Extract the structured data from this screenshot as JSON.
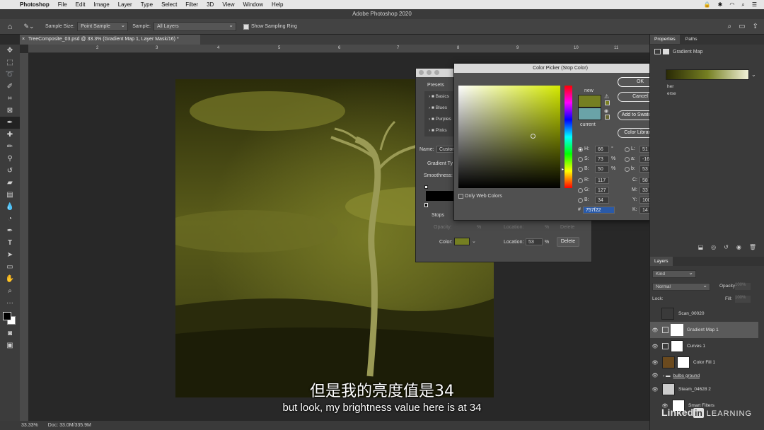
{
  "menubar": {
    "app_name": "Photoshop",
    "items": [
      "File",
      "Edit",
      "Image",
      "Layer",
      "Type",
      "Select",
      "Filter",
      "3D",
      "View",
      "Window",
      "Help"
    ]
  },
  "window_title": "Adobe Photoshop 2020",
  "options_bar": {
    "sample_size_label": "Sample Size:",
    "sample_size_value": "Point Sample",
    "sample_label": "Sample:",
    "sample_value": "All Layers",
    "show_sampling_ring": "Show Sampling Ring"
  },
  "document_tab": "TreeComposite_03.psd @ 33.3% (Gradient Map 1, Layer Mask/16) *",
  "ruler_ticks": [
    "2",
    "3",
    "4",
    "5",
    "6",
    "7",
    "8",
    "9",
    "10",
    "11"
  ],
  "status": {
    "zoom": "33.33%",
    "doc": "Doc: 33.0M/335.9M"
  },
  "gradient_editor": {
    "presets_label": "Presets",
    "presets": [
      "Basics",
      "Blues",
      "Purples",
      "Pinks"
    ],
    "name_label": "Name:",
    "name_value": "Custom",
    "gradient_type_label": "Gradient Ty",
    "smoothness_label": "Smoothness:",
    "stops_label": "Stops",
    "opacity_label": "Opacity:",
    "opacity_unit": "%",
    "location_label": "Location:",
    "delete_label": "Delete",
    "color_label": "Color:",
    "location_value": "53",
    "location_unit": "%",
    "delete_active": "Delete",
    "stop_color": "#757f22"
  },
  "color_picker": {
    "title": "Color Picker (Stop Color)",
    "ok": "OK",
    "cancel": "Cancel",
    "add_to_swatches": "Add to Swatches",
    "color_libraries": "Color Libraries",
    "new_label": "new",
    "current_label": "current",
    "new_color": "#757f22",
    "current_color": "#6aa3a8",
    "only_web_colors": "Only Web Colors",
    "hsb": [
      {
        "key": "H:",
        "value": "66",
        "unit": "°"
      },
      {
        "key": "S:",
        "value": "73",
        "unit": "%"
      },
      {
        "key": "B:",
        "value": "50",
        "unit": "%"
      }
    ],
    "rgb": [
      {
        "key": "R:",
        "value": "117"
      },
      {
        "key": "G:",
        "value": "127"
      },
      {
        "key": "B:",
        "value": "34"
      }
    ],
    "lab": [
      {
        "key": "L:",
        "value": "51"
      },
      {
        "key": "a:",
        "value": "-16"
      },
      {
        "key": "b:",
        "value": "53"
      }
    ],
    "cmyk": [
      {
        "key": "C:",
        "value": "58",
        "unit": "%"
      },
      {
        "key": "M:",
        "value": "33",
        "unit": "%"
      },
      {
        "key": "Y:",
        "value": "100",
        "unit": "%"
      },
      {
        "key": "K:",
        "value": "14",
        "unit": "%"
      }
    ],
    "hex_label": "#",
    "hex_value": "757f22"
  },
  "properties_panel": {
    "tabs": [
      "Properties",
      "Paths"
    ],
    "adjustment_name": "Gradient Map",
    "partial_labels": [
      "her",
      "erse"
    ]
  },
  "layers_panel": {
    "title": "Layers",
    "kind_placeholder": "Kind",
    "blend_mode": "Normal",
    "opacity_label": "Opacity:",
    "opacity_value": "100%",
    "lock_label": "Lock:",
    "fill_label": "Fill:",
    "fill_value": "100%",
    "layers": [
      {
        "name": "Scan_00020",
        "thumb": "#3a3a3a"
      },
      {
        "name": "Gradient Map 1",
        "thumb": "#ffffff"
      },
      {
        "name": "Curves 1",
        "thumb": "#ffffff"
      },
      {
        "name": "Color Fill 1",
        "thumb": "#6b4a1e"
      },
      {
        "name": "bulbs ground",
        "thumb": ""
      },
      {
        "name": "Steam_04628 2",
        "thumb": "#cccccc"
      },
      {
        "name": "Smart Filters",
        "thumb": "#ffffff"
      }
    ]
  },
  "subtitles": {
    "chinese": "但是我的亮度值是34",
    "english": "but look, my brightness value here is at 34"
  },
  "watermark": {
    "brand": "Linked",
    "in": "in",
    "learning": "LEARNING"
  }
}
